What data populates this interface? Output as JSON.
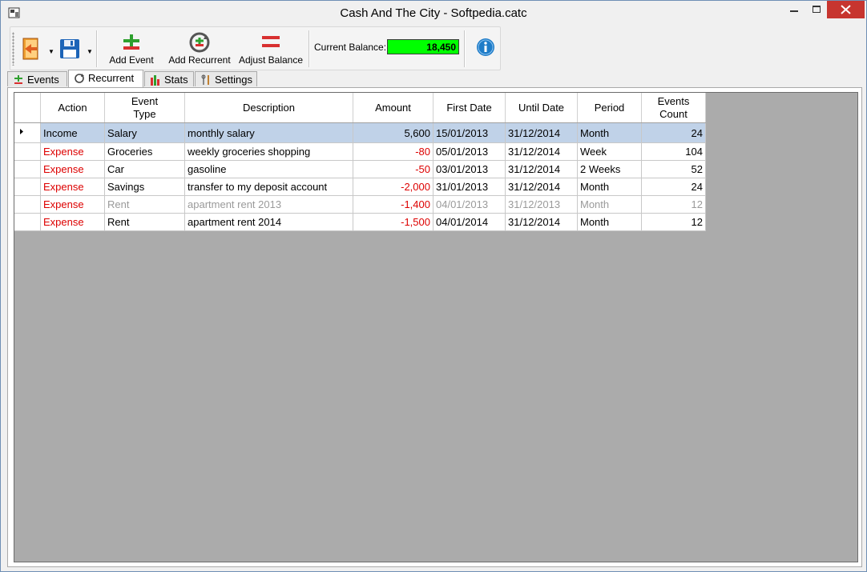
{
  "window": {
    "title": "Cash And The City - Softpedia.catc",
    "controls": [
      "minimize",
      "maximize",
      "close"
    ]
  },
  "toolbar": {
    "open_icon": "open-folder-icon",
    "save_icon": "floppy-disk-icon",
    "add_event_label": "Add Event",
    "add_recurrent_label": "Add Recurrent",
    "adjust_balance_label": "Adjust Balance",
    "balance_label": "Current Balance:",
    "balance_value": "18,450",
    "balance_color": "#00ff00",
    "info_icon": "info-icon"
  },
  "tabs": [
    {
      "label": "Events",
      "icon": "plus-minus-icon",
      "active": false
    },
    {
      "label": "Recurrent",
      "icon": "refresh-icon",
      "active": true
    },
    {
      "label": "Stats",
      "icon": "bar-chart-icon",
      "active": false
    },
    {
      "label": "Settings",
      "icon": "tools-icon",
      "active": false
    }
  ],
  "table": {
    "columns": [
      "Action",
      "Event\nType",
      "Description",
      "Amount",
      "First Date",
      "Until Date",
      "Period",
      "Events\nCount"
    ],
    "rows": [
      {
        "action": "Income",
        "type": "Salary",
        "description": "monthly salary",
        "amount": "5,600",
        "first": "15/01/2013",
        "until": "31/12/2014",
        "period": "Month",
        "count": "24",
        "selected": true,
        "inactive": false
      },
      {
        "action": "Expense",
        "type": "Groceries",
        "description": "weekly groceries shopping",
        "amount": "-80",
        "first": "05/01/2013",
        "until": "31/12/2014",
        "period": "Week",
        "count": "104",
        "selected": false,
        "inactive": false
      },
      {
        "action": "Expense",
        "type": "Car",
        "description": "gasoline",
        "amount": "-50",
        "first": "03/01/2013",
        "until": "31/12/2014",
        "period": "2 Weeks",
        "count": "52",
        "selected": false,
        "inactive": false
      },
      {
        "action": "Expense",
        "type": "Savings",
        "description": "transfer to my deposit account",
        "amount": "-2,000",
        "first": "31/01/2013",
        "until": "31/12/2014",
        "period": "Month",
        "count": "24",
        "selected": false,
        "inactive": false
      },
      {
        "action": "Expense",
        "type": "Rent",
        "description": "apartment rent 2013",
        "amount": "-1,400",
        "first": "04/01/2013",
        "until": "31/12/2013",
        "period": "Month",
        "count": "12",
        "selected": false,
        "inactive": true
      },
      {
        "action": "Expense",
        "type": "Rent",
        "description": "apartment rent 2014",
        "amount": "-1,500",
        "first": "04/01/2014",
        "until": "31/12/2014",
        "period": "Month",
        "count": "12",
        "selected": false,
        "inactive": false
      }
    ]
  }
}
